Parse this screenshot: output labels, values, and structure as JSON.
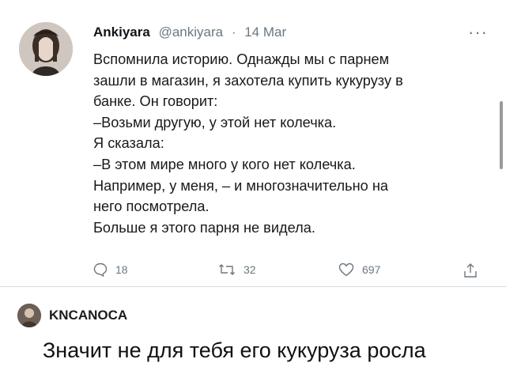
{
  "tweet": {
    "author_name": "Ankiyara",
    "author_handle": "@ankiyara",
    "date_separator": "·",
    "date": "14 Mar",
    "more_icon": "more-icon",
    "lines": [
      "Вспомнила историю. Однажды мы с парнем",
      "зашли в магазин, я захотела купить кукурузу в",
      "банке. Он говорит:",
      "–Возьми другую, у этой нет колечка.",
      "Я сказала:",
      "–В этом мире много у кого нет колечка.",
      "Например, у меня, – и многозначительно на",
      "него посмотрела.",
      "Больше я этого парня не видела."
    ],
    "actions": {
      "reply_count": "18",
      "retweet_count": "32",
      "like_count": "697"
    }
  },
  "comment": {
    "author": "KNCANOCA",
    "text": "Значит не для тебя его кукуруза росла"
  },
  "colors": {
    "muted": "#6b7780",
    "text": "#0f1419"
  }
}
